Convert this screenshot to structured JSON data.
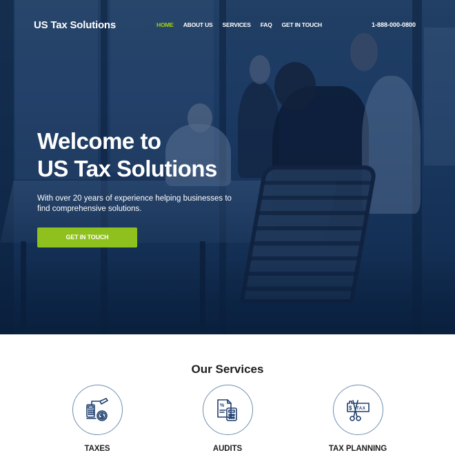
{
  "brand": {
    "name": "US Tax Solutions"
  },
  "nav": {
    "items": [
      {
        "label": "HOME",
        "active": true
      },
      {
        "label": "ABOUT US",
        "active": false
      },
      {
        "label": "SERVICES",
        "active": false
      },
      {
        "label": "FAQ",
        "active": false
      },
      {
        "label": "GET IN TOUCH",
        "active": false
      }
    ],
    "phone": "1-888-000-0800"
  },
  "hero": {
    "title_line1": "Welcome to",
    "title_line2": "US Tax Solutions",
    "subtitle": "With over 20 years of experience helping businesses to find comprehensive solutions.",
    "cta_label": "GET IN TOUCH",
    "background_image": "office-meeting-photo"
  },
  "services": {
    "title": "Our Services",
    "items": [
      {
        "label": "TAXES",
        "icon": "calculator-dollar-icon"
      },
      {
        "label": "AUDITS",
        "icon": "document-calculator-icon"
      },
      {
        "label": "TAX PLANNING",
        "icon": "tax-scissors-icon"
      }
    ]
  },
  "colors": {
    "accent": "#a4d30f",
    "button": "#8fc11e",
    "hero_overlay": "#1a365b",
    "icon_stroke": "#1f3f6e",
    "circle_border": "#6d8db1",
    "heading_text": "#1d1d1d"
  }
}
